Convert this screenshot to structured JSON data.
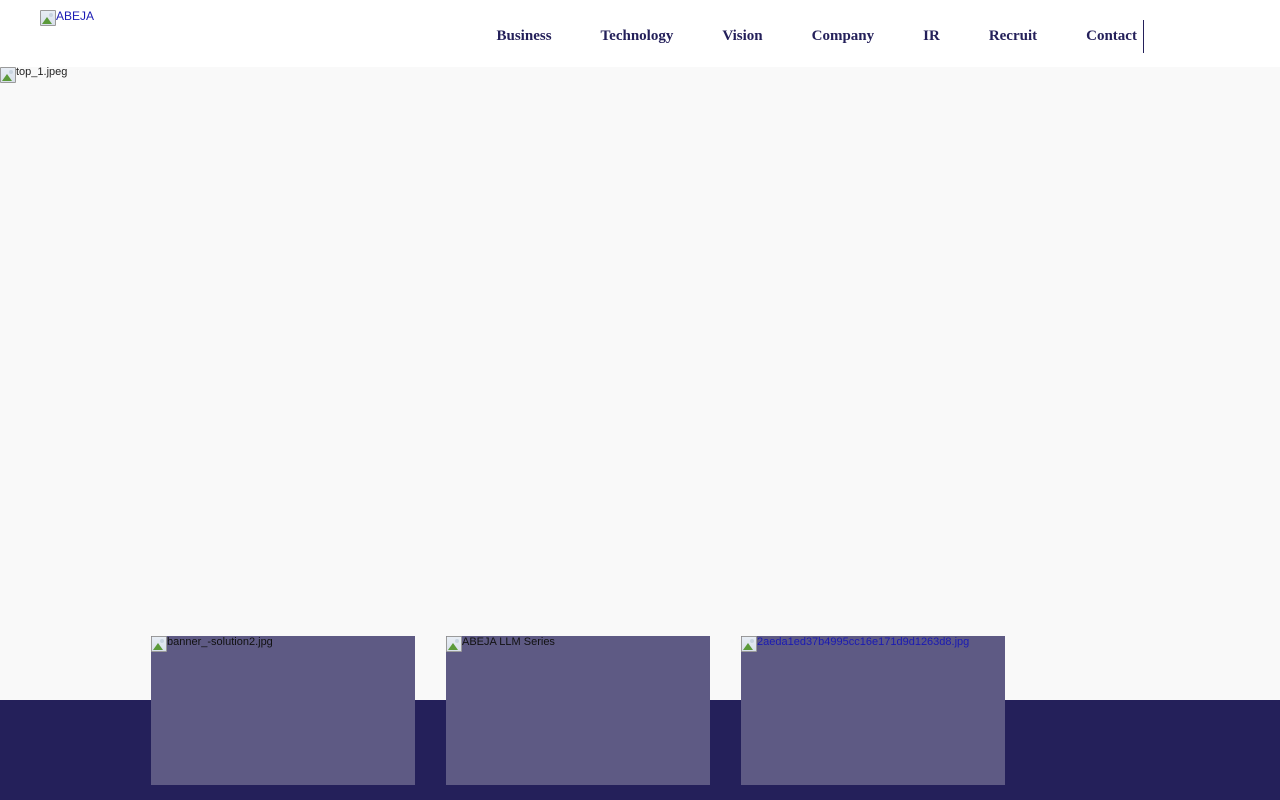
{
  "header": {
    "logo_alt": "ABEJA",
    "nav": [
      {
        "label": "Business"
      },
      {
        "label": "Technology"
      },
      {
        "label": "Vision"
      },
      {
        "label": "Company"
      },
      {
        "label": "IR"
      },
      {
        "label": "Recruit"
      },
      {
        "label": "Contact"
      }
    ]
  },
  "hero": {
    "image_alt": "top_1.jpeg"
  },
  "banners": [
    {
      "alt": "banner_-solution2.jpg"
    },
    {
      "alt": "ABEJA LLM Series"
    },
    {
      "alt": "2aeda1ed37b4995cc16e171d9d1263d8.jpg"
    }
  ],
  "colors": {
    "nav_text": "#24205a",
    "band": "#24205a",
    "card": "#5e5a84",
    "hero_bg": "#f9f9f9",
    "link": "#1a1ab4"
  },
  "icons": {
    "broken_image": "broken-image-icon"
  }
}
